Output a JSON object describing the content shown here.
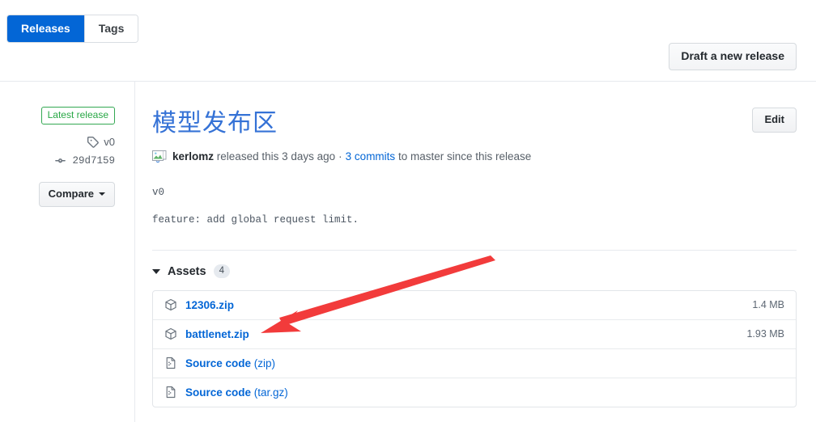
{
  "tabs": [
    {
      "label": "Releases",
      "active": true
    },
    {
      "label": "Tags",
      "active": false
    }
  ],
  "header": {
    "draft_button": "Draft a new release"
  },
  "sidebar": {
    "latest_badge": "Latest release",
    "tag_icon": "tag-icon",
    "tag_name": "v0",
    "commit_icon": "commit-icon",
    "commit_sha": "29d7159",
    "compare_button": "Compare"
  },
  "release": {
    "edit_button": "Edit",
    "title": "模型发布区",
    "avatar_icon": "broken-image-avatar-icon",
    "author": "kerlomz",
    "released_text": "released this",
    "time_ago": "3 days ago",
    "separator": "·",
    "commits_link": "3 commits",
    "branch_text": "to master since this release",
    "body_lines": [
      "v0",
      "feature: add global request limit."
    ]
  },
  "assets": {
    "caret_icon": "triangle-down-icon",
    "label": "Assets",
    "count": "4",
    "rows": [
      {
        "icon": "package-icon",
        "name": "12306.zip",
        "suffix": "",
        "size": "1.4 MB"
      },
      {
        "icon": "package-icon",
        "name": "battlenet.zip",
        "suffix": "",
        "size": "1.93 MB"
      },
      {
        "icon": "file-zip-icon",
        "name": "Source code",
        "suffix": " (zip)",
        "size": ""
      },
      {
        "icon": "file-zip-icon",
        "name": "Source code",
        "suffix": " (tar.gz)",
        "size": ""
      }
    ]
  },
  "annotation": {
    "color": "#f23b3b",
    "shape": "arrow",
    "points_at": "battlenet.zip"
  },
  "colors": {
    "accent_blue": "#0366d6",
    "title_blue": "#3572d6",
    "badge_green": "#28a745",
    "muted_text": "#586069",
    "border": "#e2e5e9"
  }
}
